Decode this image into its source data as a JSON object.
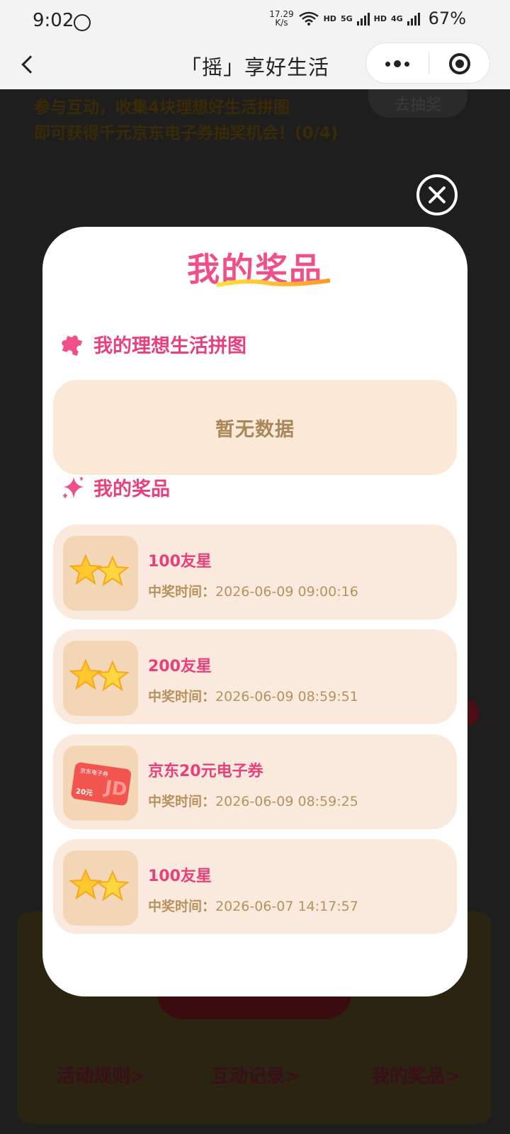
{
  "status_bar": {
    "time": "9:02",
    "net_speed_value": "17.29",
    "net_speed_unit": "K/s",
    "hd1": "HD",
    "net1": "5G",
    "hd2": "HD",
    "net2": "4G",
    "battery": "67%"
  },
  "nav": {
    "title": "「摇」享好生活"
  },
  "background": {
    "line1": "参与互动，收集4块理想好生活拼图",
    "line2": "即可获得千元京东电子券抽奖机会！(0/4)",
    "pill": "去抽奖",
    "footer_rules": "活动规则>",
    "footer_records": "互动记录>",
    "footer_prizes": "我的奖品>"
  },
  "modal": {
    "title": "我的奖品",
    "puzzle_section_label": "我的理想生活拼图",
    "puzzle_empty_text": "暂无数据",
    "prizes_section_label": "我的奖品",
    "time_label": "中奖时间：",
    "prizes": [
      {
        "name": "100友星",
        "time": "2026-06-09 09:00:16",
        "icon": "stars-icon"
      },
      {
        "name": "200友星",
        "time": "2026-06-09 08:59:51",
        "icon": "stars-icon"
      },
      {
        "name": "京东20元电子券",
        "time": "2026-06-09 08:59:25",
        "icon": "jd-coupon-icon",
        "coupon_text": "京东电子券",
        "coupon_value": "20元"
      },
      {
        "name": "100友星",
        "time": "2026-06-07 14:17:57",
        "icon": "stars-icon"
      }
    ]
  },
  "colors": {
    "accent_pink": "#e83f7d",
    "card_bg": "#faeadd",
    "muted_gold": "#b7925f"
  }
}
